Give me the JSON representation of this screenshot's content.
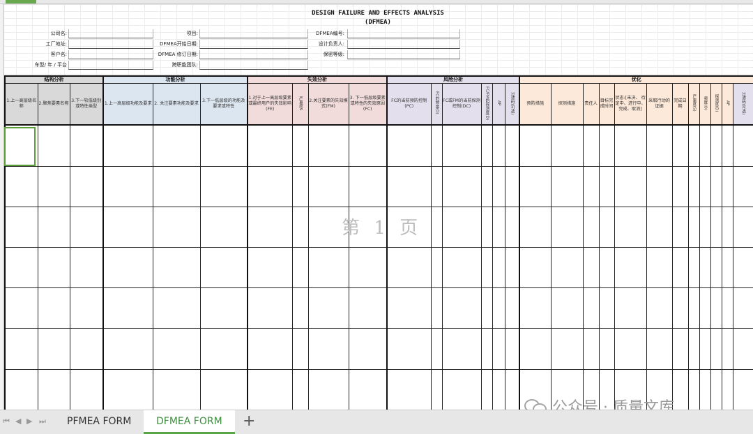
{
  "document": {
    "title": "DESIGN FAILURE AND EFFECTS ANALYSIS",
    "subtitle": "(DFMEA)"
  },
  "fields": {
    "company": "公司名:",
    "plant": "工厂地址:",
    "customer": "客户名:",
    "model": "车型/ 年 / 平台",
    "project": "项目:",
    "start_date": "DFMEA开始日期:",
    "revision_date": "DFMEA 修订日期:",
    "team": "跨职能团队:",
    "dfmea_no": "DFMEA编号:",
    "owner": "设计负责人:",
    "confidentiality": "保密等级:"
  },
  "sections": {
    "structure": "结构分析",
    "function": "功能分析",
    "failure": "失效分析",
    "risk": "风险分析",
    "optimization": "优化"
  },
  "columns": {
    "c1": "1.上一高层级名称",
    "c2": "2.聚焦要素名称",
    "c3": "3.下一较低级别或特性类型",
    "c4": "1.上一高层级功能及要求",
    "c5": "2. 关注要素功能及要求",
    "c6": "3.下一低层级的功能及要求或特性",
    "c7": "1.对于上一高层级要素或最终用户的失效影响(FE)",
    "c8": "严重度S",
    "c9": "2.关注要素的失效模式(FM)",
    "c10": "3. 下一低层级要素或特性的失效原因(FC)",
    "c11": "FC的当前预防控制(PC)",
    "c12": "FC的频度(O)",
    "c13": "FC或FM的当前探测控制(DC)",
    "c14": "FC/FM的探测度(D)",
    "c15": "AP",
    "c16": "过滤码(可选)",
    "c17": "预防措施",
    "c18": "探测措施",
    "c19": "责任人",
    "c20": "目标完成时间",
    "c21": "状态:[未决、 待定中、进行中、完成、取消]",
    "c22": "采取行动的证据",
    "c23": "完成日期",
    "c24": "严重度(S)",
    "c25": "频度(O)",
    "c26": "探测度(D)",
    "c27": "AP",
    "c28": "过滤码(可选)"
  },
  "watermark": {
    "page": "第 1 页",
    "wechat": "公众号 · 质量文库"
  },
  "tabs": {
    "sheet1": "PFMEA FORM",
    "sheet2": "DFMEA FORM",
    "add": "+",
    "active": "DFMEA FORM"
  },
  "colors": {
    "structure": "#d9d9d9",
    "function": "#dce6f1",
    "failure": "#f2dcdb",
    "risk": "#e4dfec",
    "optimization": "#fde9d9",
    "active_tab": "#3f8f3f"
  }
}
